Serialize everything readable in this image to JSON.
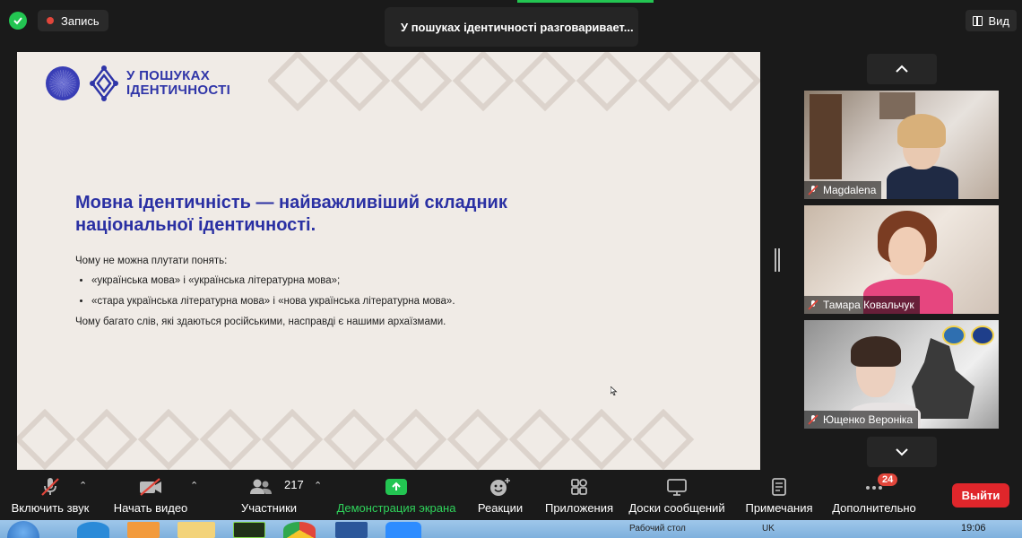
{
  "topbar": {
    "recording_label": "Запись",
    "meeting_title": "У пошуках ідентичності разговаривает...",
    "view_label": "Вид"
  },
  "slide": {
    "logo_text_line1": "У ПОШУКАХ",
    "logo_text_line2": "ІДЕНТИЧНОСТІ",
    "heading_line1": "Мовна ідентичність — найважливіший складник",
    "heading_line2": "національної  ідентичності.",
    "intro": "Чому не можна плутати понять:",
    "bullets": [
      "«українська мова» і «українська літературна мова»;",
      "«стара українська літературна мова» і «нова українська літературна мова»."
    ],
    "outro": "Чому багато слів, які здаються російськими, насправді є нашими архаїзмами."
  },
  "participants": [
    {
      "name": "Magdalena"
    },
    {
      "name": "Тамара Ковальчук"
    },
    {
      "name": "Ющенко Вероніка"
    }
  ],
  "toolbar": {
    "mute_label": "Включить звук",
    "video_label": "Начать видео",
    "participants_label": "Участники",
    "participants_count": "217",
    "share_label": "Демонстрация экрана",
    "reactions_label": "Реакции",
    "apps_label": "Приложения",
    "whiteboard_label": "Доски сообщений",
    "notes_label": "Примечания",
    "more_label": "Дополнительно",
    "more_badge": "24",
    "leave_label": "Выйти"
  },
  "taskbar": {
    "desktop_label": "Рабочий стол",
    "lang": "UK",
    "time": "19:06"
  },
  "colors": {
    "accent_green": "#23c552",
    "leave_red": "#e0262b",
    "slide_blue": "#2a30a3",
    "slide_bg": "#f0ebe6"
  }
}
